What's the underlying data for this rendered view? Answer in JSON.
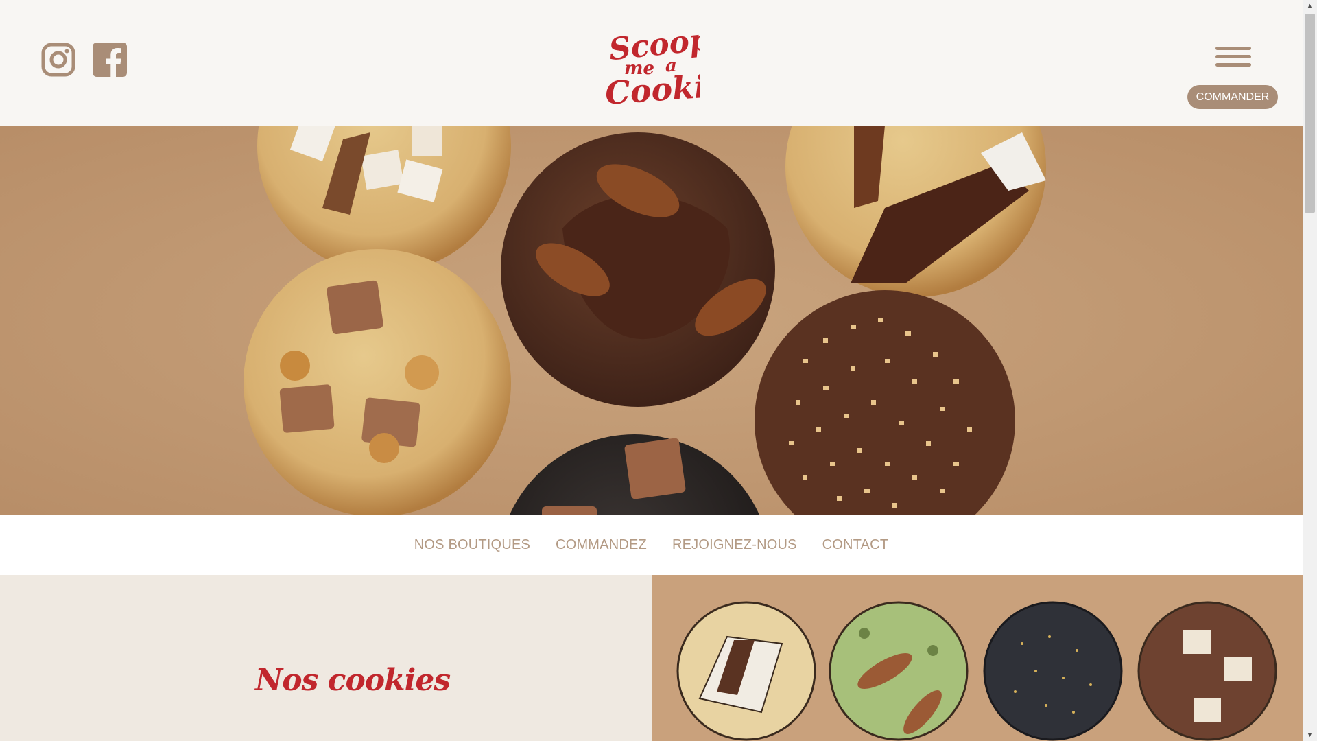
{
  "header": {
    "logo_text": [
      "Scoop",
      "me",
      "a",
      "Cookie"
    ],
    "order_label": "COMMANDER"
  },
  "nav": {
    "items": [
      "NOS BOUTIQUES",
      "COMMANDEZ",
      "REJOIGNEZ-NOUS",
      "CONTACT"
    ]
  },
  "section": {
    "title": "Nos cookies"
  },
  "icons": {
    "instagram": "instagram-icon",
    "facebook": "facebook-icon",
    "menu": "hamburger-menu-icon"
  },
  "colors": {
    "brand_red": "#c1272d",
    "accent_brown": "#a98d77",
    "nav_text": "#b39a84",
    "header_bg": "#f8f6f3",
    "section_bg": "#efe9e1"
  }
}
